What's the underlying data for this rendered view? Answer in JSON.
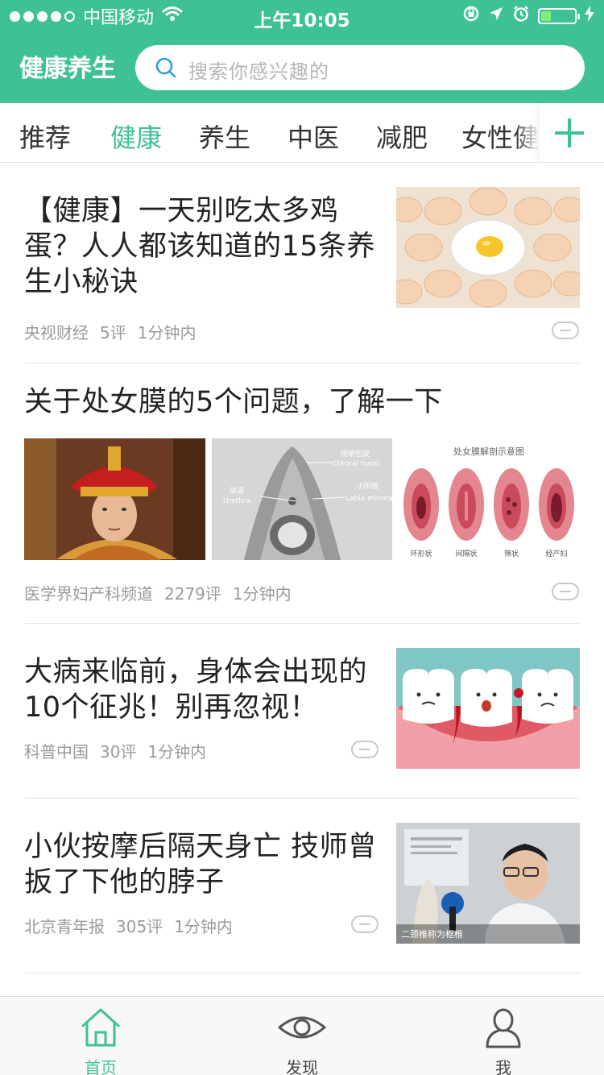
{
  "status_bar": {
    "carrier": "中国移动",
    "time": "上午10:05",
    "battery_level": 0.3,
    "signal_bars": 4,
    "signal_max": 5
  },
  "header": {
    "app_title": "健康养生",
    "search_placeholder": "搜索你感兴趣的"
  },
  "colors": {
    "brand": "#3fc196",
    "meta_text": "#9a9a9a",
    "title_text": "#222222"
  },
  "tabs": [
    {
      "label": "推荐",
      "active": false
    },
    {
      "label": "健康",
      "active": true
    },
    {
      "label": "养生",
      "active": false
    },
    {
      "label": "中医",
      "active": false
    },
    {
      "label": "减肥",
      "active": false
    },
    {
      "label": "女性健康",
      "active": false
    }
  ],
  "articles": [
    {
      "title": "【健康】一天别吃太多鸡蛋？人人都该知道的15条养生小秘诀",
      "source": "央视财经",
      "comments": "5评",
      "time": "1分钟内",
      "images": [
        "eggs-photo"
      ]
    },
    {
      "title": "关于处女膜的5个问题，了解一下",
      "source": "医学界妇产科频道",
      "comments": "2279评",
      "time": "1分钟内",
      "images": [
        "emperor-costume-photo",
        "anatomy-diagram",
        "hymen-types-diagram"
      ],
      "image_labels": {
        "anatomy": [
          "阴蒂包皮",
          "Clitoral hood",
          "尿道",
          "Urethra",
          "小阴唇",
          "Labia minora"
        ],
        "types_title": "处女膜解剖示意图",
        "types": [
          "环形状",
          "间隔状",
          "筛状",
          "经产妇"
        ]
      }
    },
    {
      "title": "大病来临前，身体会出现的10个征兆！别再忽视！",
      "source": "科普中国",
      "comments": "30评",
      "time": "1分钟内",
      "images": [
        "teeth-cartoon"
      ]
    },
    {
      "title": "小伙按摩后隔天身亡 技师曾扳了下他的脖子",
      "source": "北京青年报",
      "comments": "305评",
      "time": "1分钟内",
      "images": [
        "doctor-news-photo"
      ],
      "image_caption": "二颈椎称为枢椎"
    }
  ],
  "tabbar": [
    {
      "label": "首页",
      "icon": "home-icon",
      "active": true
    },
    {
      "label": "发现",
      "icon": "eye-icon",
      "active": false
    },
    {
      "label": "我",
      "icon": "person-icon",
      "active": false
    }
  ]
}
